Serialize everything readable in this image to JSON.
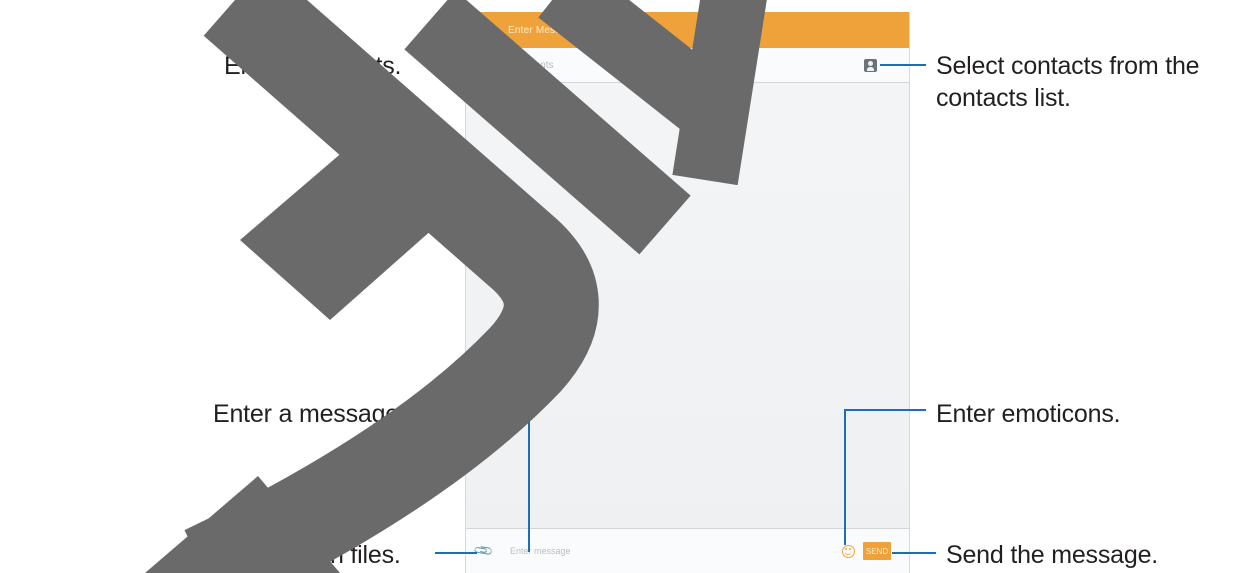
{
  "screen": {
    "title": "Enter Message",
    "recipients_placeholder": "Enter recipients",
    "message_placeholder": "Enter message",
    "send_label": "SEND",
    "accent_color": "#f0a23a",
    "icons": {
      "back": "back-arrow-icon",
      "contacts": "contacts-icon",
      "attach": "paperclip-icon",
      "emoticon": "emoticon-icon"
    }
  },
  "callouts": {
    "enter_recipients": "Enter recipients.",
    "select_contacts": "Select contacts from the contacts list.",
    "enter_message": "Enter a message.",
    "attach_files": "Attach files.",
    "enter_emoticons": "Enter emoticons.",
    "send_message": "Send the message."
  },
  "colors": {
    "leader_line": "#1c6fb6",
    "text": "#231f20"
  }
}
